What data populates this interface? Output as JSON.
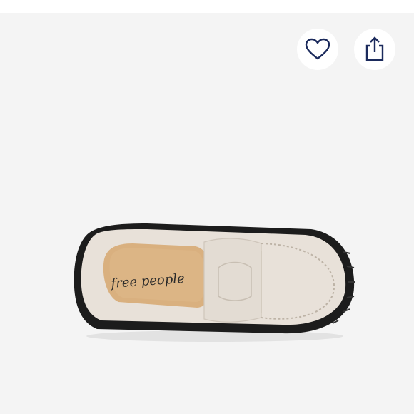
{
  "header": {
    "partial_text": "",
    "background_color": "#ffffff"
  },
  "product": {
    "image_background": "#f4f4f4",
    "shoe_logo_text": "free people",
    "shoe_colors": {
      "upper": "#e8e1d9",
      "sole": "#1c1c1c",
      "insole": "#d9b07f"
    }
  },
  "actions": {
    "like_icon": "heart-icon",
    "share_icon": "share-icon",
    "icon_color": "#1b2a5c"
  }
}
